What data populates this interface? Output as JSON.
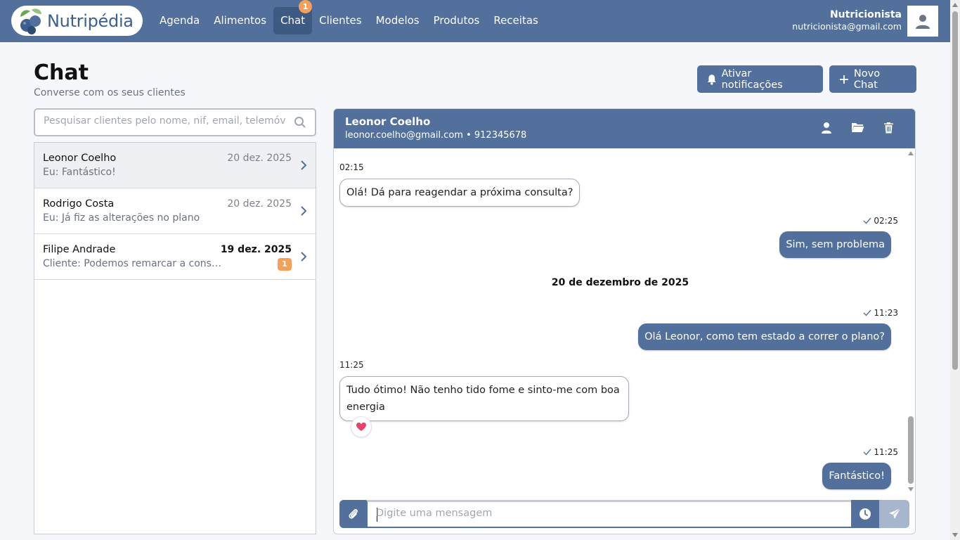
{
  "brand": {
    "name": "Nutripédia"
  },
  "nav": {
    "items": [
      {
        "label": "Agenda"
      },
      {
        "label": "Alimentos"
      },
      {
        "label": "Chat",
        "badge": "1"
      },
      {
        "label": "Clientes"
      },
      {
        "label": "Modelos"
      },
      {
        "label": "Produtos"
      },
      {
        "label": "Receitas"
      }
    ]
  },
  "user": {
    "name": "Nutricionista",
    "email": "nutricionista@gmail.com"
  },
  "page": {
    "title": "Chat",
    "subtitle": "Converse com os seus clientes",
    "notif_label": "Ativar notificações",
    "new_chat_label": "Novo Chat"
  },
  "search": {
    "placeholder": "Pesquisar clientes pelo nome, nif, email, telemóvel"
  },
  "conversations": [
    {
      "name": "Leonor Coelho",
      "preview": "Eu: Fantástico!",
      "date": "20 dez. 2025",
      "unread": ""
    },
    {
      "name": "Rodrigo Costa",
      "preview": "Eu: Já fiz as alterações no plano",
      "date": "20 dez. 2025",
      "unread": ""
    },
    {
      "name": "Filipe Andrade",
      "preview": "Cliente: Podemos remarcar a consulta para outro dia?",
      "date": "19 dez. 2025",
      "unread": "1"
    }
  ],
  "chat": {
    "contact_name": "Leonor Coelho",
    "contact_info": "leonor.coelho@gmail.com • 912345678",
    "messages": [
      {
        "time": "02:15",
        "text": "Olá! Dá para reagendar a próxima consulta?",
        "direction": "in"
      },
      {
        "time": "02:25",
        "text": "Sim, sem problema",
        "direction": "out"
      },
      {
        "time": "11:23",
        "text": "Olá Leonor, como tem estado a correr o plano?",
        "direction": "out"
      },
      {
        "time": "11:25",
        "text": "Tudo ótimo! Não tenho tido fome e sinto-me com boa energia",
        "direction": "in",
        "reaction": "heart"
      },
      {
        "time": "11:25",
        "text": "Fantástico!",
        "direction": "out"
      }
    ],
    "date_separator": "20 de dezembro de 2025",
    "input_placeholder": "Digite uma mensagem"
  },
  "colors": {
    "primary": "#52709b",
    "accent": "#f2a05a",
    "send_disabled": "#a7b6cc"
  }
}
